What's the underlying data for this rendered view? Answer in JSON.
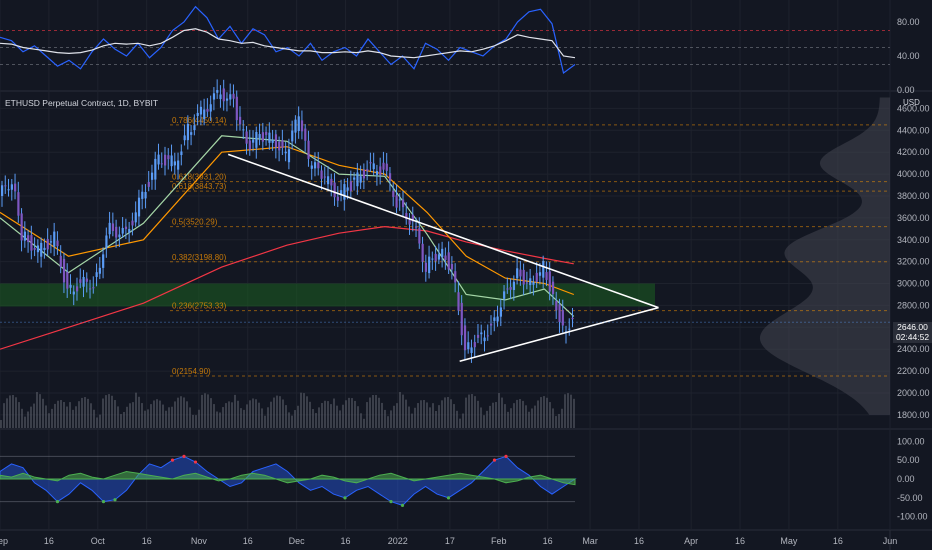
{
  "header": {
    "symbol_line": "ETHUSD Perpetual Contract, 1D, BYBIT",
    "currency": "USD"
  },
  "price_tag": {
    "price": "2646.00",
    "countdown": "02:44:52"
  },
  "colors": {
    "background": "#131722",
    "grid": "#1e222d",
    "candle": "#5b9cf6",
    "trendline": "#ffffff",
    "sma_red": "#f23645",
    "ema_orange": "#ff9800",
    "ema_green": "#a5d6a7",
    "support_zone": "#1b5e20",
    "oscillator_blue": "#2962ff",
    "oscillator_green": "#4caf50",
    "oscillator_red": "#f23645"
  },
  "chart_data": [
    {
      "type": "line",
      "name": "RSI panel",
      "y_ticks": [
        "80.00",
        "40.00",
        "0.00"
      ],
      "ylim": [
        0,
        100
      ],
      "reference_levels": [
        70,
        50,
        30
      ],
      "x": [
        0,
        1,
        2,
        3,
        4,
        5,
        6,
        7,
        8,
        9,
        10,
        11,
        12,
        13,
        14,
        15,
        16,
        17,
        18,
        19,
        20,
        21,
        22,
        23,
        24,
        25,
        26,
        27,
        28,
        29,
        30,
        31,
        32,
        33,
        34,
        35,
        36,
        37,
        38,
        39,
        40,
        41,
        42,
        43,
        44,
        45,
        46,
        47,
        48,
        49,
        50
      ],
      "series": [
        {
          "color": "#2962ff",
          "values": [
            62,
            58,
            45,
            52,
            40,
            28,
            35,
            25,
            45,
            60,
            48,
            40,
            55,
            38,
            50,
            70,
            80,
            98,
            85,
            60,
            75,
            55,
            72,
            65,
            45,
            50,
            40,
            55,
            35,
            45,
            50,
            40,
            60,
            45,
            30,
            40,
            25,
            55,
            48,
            35,
            50,
            45,
            40,
            52,
            60,
            80,
            92,
            95,
            78,
            20,
            30
          ]
        },
        {
          "color": "#e0e3eb",
          "values": [
            55,
            54,
            50,
            48,
            46,
            44,
            43,
            44,
            47,
            52,
            55,
            54,
            55,
            52,
            55,
            62,
            70,
            72,
            68,
            60,
            58,
            55,
            56,
            52,
            50,
            48,
            46,
            46,
            44,
            44,
            45,
            44,
            46,
            44,
            40,
            39,
            38,
            40,
            42,
            44,
            46,
            45,
            48,
            52,
            58,
            65,
            62,
            60,
            58,
            40,
            38
          ]
        }
      ]
    },
    {
      "type": "candlestick",
      "name": "ETHUSD 1D",
      "y_ticks": [
        "4600.00",
        "4400.00",
        "4200.00",
        "4000.00",
        "3800.00",
        "3600.00",
        "3400.00",
        "3200.00",
        "3000.00",
        "2800.00",
        "2600.00",
        "2400.00",
        "2200.00",
        "2000.00",
        "1800.00"
      ],
      "ylim": [
        1680,
        4750
      ],
      "x_ticks": [
        "Sep",
        "16",
        "Oct",
        "16",
        "Nov",
        "16",
        "Dec",
        "16",
        "2022",
        "17",
        "Feb",
        "16",
        "Mar",
        "16",
        "Apr",
        "16",
        "May",
        "16",
        "Jun"
      ],
      "x_tick_dates": [
        "2021-09-01",
        "2021-09-16",
        "2021-10-01",
        "2021-10-16",
        "2021-11-01",
        "2021-11-16",
        "2021-12-01",
        "2021-12-16",
        "2022-01-01",
        "2022-01-17",
        "2022-02-01",
        "2022-02-16",
        "2022-03-01",
        "2022-03-16",
        "2022-04-01",
        "2022-04-16",
        "2022-05-01",
        "2022-05-16",
        "2022-06-01"
      ],
      "closes": [
        {
          "date": "2021-09-01",
          "close": 3800
        },
        {
          "date": "2021-09-05",
          "close": 3950
        },
        {
          "date": "2021-09-08",
          "close": 3450
        },
        {
          "date": "2021-09-13",
          "close": 3300
        },
        {
          "date": "2021-09-18",
          "close": 3420
        },
        {
          "date": "2021-09-22",
          "close": 2950
        },
        {
          "date": "2021-09-27",
          "close": 3000
        },
        {
          "date": "2021-09-30",
          "close": 3000
        },
        {
          "date": "2021-10-05",
          "close": 3500
        },
        {
          "date": "2021-10-10",
          "close": 3450
        },
        {
          "date": "2021-10-15",
          "close": 3800
        },
        {
          "date": "2021-10-20",
          "close": 4150
        },
        {
          "date": "2021-10-25",
          "close": 4100
        },
        {
          "date": "2021-10-29",
          "close": 4400
        },
        {
          "date": "2021-11-03",
          "close": 4600
        },
        {
          "date": "2021-11-08",
          "close": 4750
        },
        {
          "date": "2021-11-12",
          "close": 4650
        },
        {
          "date": "2021-11-16",
          "close": 4250
        },
        {
          "date": "2021-11-20",
          "close": 4350
        },
        {
          "date": "2021-11-25",
          "close": 4300
        },
        {
          "date": "2021-11-28",
          "close": 4150
        },
        {
          "date": "2021-12-02",
          "close": 4550
        },
        {
          "date": "2021-12-05",
          "close": 4100
        },
        {
          "date": "2021-12-09",
          "close": 4000
        },
        {
          "date": "2021-12-14",
          "close": 3800
        },
        {
          "date": "2021-12-18",
          "close": 3900
        },
        {
          "date": "2021-12-23",
          "close": 4050
        },
        {
          "date": "2021-12-28",
          "close": 4050
        },
        {
          "date": "2022-01-01",
          "close": 3750
        },
        {
          "date": "2022-01-06",
          "close": 3550
        },
        {
          "date": "2022-01-10",
          "close": 3150
        },
        {
          "date": "2022-01-14",
          "close": 3300
        },
        {
          "date": "2022-01-18",
          "close": 3150
        },
        {
          "date": "2022-01-22",
          "close": 2400
        },
        {
          "date": "2022-01-26",
          "close": 2500
        },
        {
          "date": "2022-01-30",
          "close": 2600
        },
        {
          "date": "2022-02-03",
          "close": 2900
        },
        {
          "date": "2022-02-07",
          "close": 3100
        },
        {
          "date": "2022-02-11",
          "close": 3000
        },
        {
          "date": "2022-02-15",
          "close": 3150
        },
        {
          "date": "2022-02-18",
          "close": 2900
        },
        {
          "date": "2022-02-21",
          "close": 2600
        },
        {
          "date": "2022-02-24",
          "close": 2646
        }
      ],
      "indicators": [
        {
          "color": "#f23645",
          "values": [
            {
              "date": "2021-09-01",
              "value": 2400
            },
            {
              "date": "2021-09-22",
              "value": 2600
            },
            {
              "date": "2021-10-15",
              "value": 2820
            },
            {
              "date": "2021-11-08",
              "value": 3150
            },
            {
              "date": "2021-11-28",
              "value": 3350
            },
            {
              "date": "2021-12-14",
              "value": 3460
            },
            {
              "date": "2021-12-28",
              "value": 3520
            },
            {
              "date": "2022-01-10",
              "value": 3480
            },
            {
              "date": "2022-01-22",
              "value": 3380
            },
            {
              "date": "2022-02-03",
              "value": 3300
            },
            {
              "date": "2022-02-15",
              "value": 3230
            },
            {
              "date": "2022-02-24",
              "value": 3180
            }
          ]
        },
        {
          "color": "#ff9800",
          "values": [
            {
              "date": "2021-09-01",
              "value": 3650
            },
            {
              "date": "2021-09-22",
              "value": 3250
            },
            {
              "date": "2021-10-15",
              "value": 3400
            },
            {
              "date": "2021-11-08",
              "value": 4200
            },
            {
              "date": "2021-11-28",
              "value": 4250
            },
            {
              "date": "2021-12-14",
              "value": 4080
            },
            {
              "date": "2021-12-28",
              "value": 4000
            },
            {
              "date": "2022-01-10",
              "value": 3650
            },
            {
              "date": "2022-01-22",
              "value": 3250
            },
            {
              "date": "2022-02-03",
              "value": 3050
            },
            {
              "date": "2022-02-15",
              "value": 3000
            },
            {
              "date": "2022-02-24",
              "value": 2900
            }
          ]
        },
        {
          "color": "#a5d6a7",
          "values": [
            {
              "date": "2021-09-01",
              "value": 3600
            },
            {
              "date": "2021-09-22",
              "value": 3100
            },
            {
              "date": "2021-10-15",
              "value": 3550
            },
            {
              "date": "2021-11-08",
              "value": 4350
            },
            {
              "date": "2021-11-28",
              "value": 4300
            },
            {
              "date": "2021-12-14",
              "value": 4000
            },
            {
              "date": "2021-12-28",
              "value": 3980
            },
            {
              "date": "2022-01-10",
              "value": 3450
            },
            {
              "date": "2022-01-22",
              "value": 2900
            },
            {
              "date": "2022-02-03",
              "value": 2850
            },
            {
              "date": "2022-02-15",
              "value": 2950
            },
            {
              "date": "2022-02-24",
              "value": 2700
            }
          ]
        }
      ],
      "zones": [
        {
          "from": 2790,
          "to": 3000,
          "color": "#1b5e20"
        }
      ],
      "fib_levels": [
        {
          "label": "0.786(4450.14)",
          "value": 4450
        },
        {
          "label": "0.618(3931.20)",
          "value": 3931
        },
        {
          "label": "0.618(3843.73)",
          "value": 3844
        },
        {
          "label": "0.5(3520.29)",
          "value": 3520
        },
        {
          "label": "0.382(3198.80)",
          "value": 3199
        },
        {
          "label": "0.236(2753.33)",
          "value": 2753
        },
        {
          "label": "0(2154.90)",
          "value": 2155
        }
      ],
      "trendlines": [
        {
          "from": {
            "date": "2021-11-10",
            "price": 4180
          },
          "to": {
            "date": "2022-03-22",
            "price": 2780
          }
        },
        {
          "from": {
            "date": "2022-01-20",
            "price": 2290
          },
          "to": {
            "date": "2022-03-22",
            "price": 2780
          }
        }
      ]
    },
    {
      "type": "area",
      "name": "Oscillator panel",
      "y_ticks": [
        "100.00",
        "50.00",
        "0.00",
        "-50.00",
        "-100.00"
      ],
      "ylim": [
        -130,
        130
      ],
      "reference_levels": [
        60,
        -60
      ],
      "x": [
        0,
        1,
        2,
        3,
        4,
        5,
        6,
        7,
        8,
        9,
        10,
        11,
        12,
        13,
        14,
        15,
        16,
        17,
        18,
        19,
        20,
        21,
        22,
        23,
        24,
        25,
        26,
        27,
        28,
        29,
        30,
        31,
        32,
        33,
        34,
        35,
        36,
        37,
        38,
        39,
        40,
        41,
        42,
        43,
        44,
        45,
        46,
        47,
        48,
        49,
        50
      ],
      "series": [
        {
          "color": "#2962ff",
          "values": [
            20,
            40,
            30,
            -10,
            -30,
            -60,
            -40,
            -10,
            -30,
            -60,
            -55,
            -30,
            10,
            40,
            30,
            50,
            60,
            45,
            20,
            0,
            -20,
            -10,
            20,
            30,
            40,
            20,
            -10,
            -30,
            -20,
            -40,
            -50,
            -30,
            -20,
            -40,
            -60,
            -70,
            -40,
            -20,
            -40,
            -50,
            -30,
            -10,
            20,
            50,
            60,
            30,
            10,
            -20,
            -40,
            -20,
            0
          ]
        },
        {
          "color": "#4caf50",
          "values": [
            10,
            5,
            15,
            5,
            0,
            -5,
            10,
            15,
            5,
            0,
            10,
            20,
            15,
            10,
            5,
            0,
            10,
            15,
            5,
            -5,
            0,
            10,
            15,
            10,
            0,
            -10,
            -5,
            0,
            10,
            5,
            -5,
            -10,
            0,
            10,
            15,
            5,
            -5,
            0,
            5,
            10,
            15,
            10,
            5,
            0,
            -10,
            -5,
            5,
            10,
            0,
            -10,
            -15
          ]
        }
      ]
    }
  ]
}
